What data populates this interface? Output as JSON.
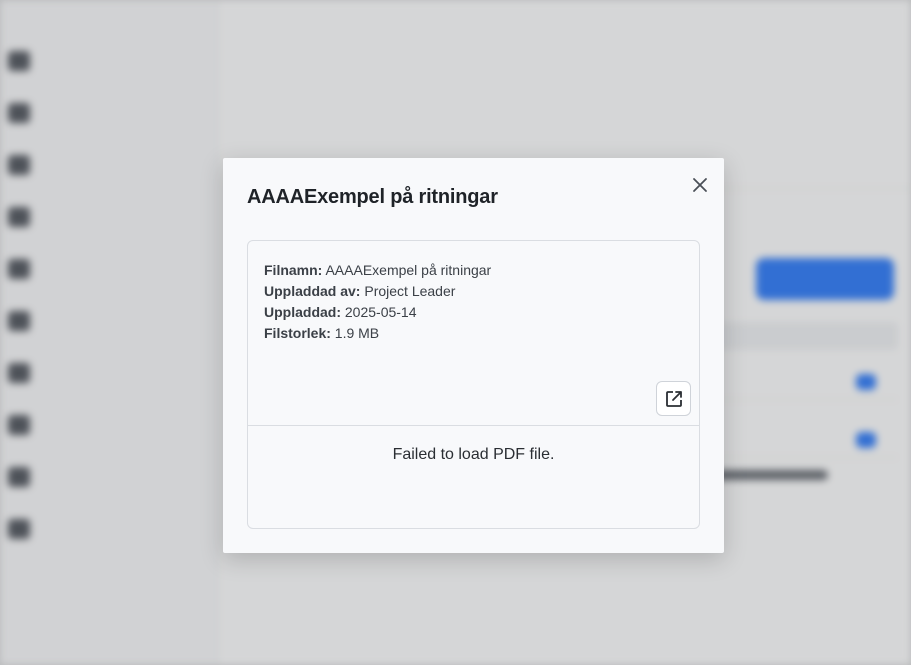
{
  "modal": {
    "title": "AAAAExempel på ritningar",
    "close_icon": "close-icon",
    "open_external_icon": "external-link-icon",
    "file_info": {
      "name_label": "Filnamn:",
      "name_value": "AAAAExempel på ritningar",
      "uploaded_by_label": "Uppladdad av:",
      "uploaded_by_value": "Project Leader",
      "uploaded_label": "Uppladdad:",
      "uploaded_value": "2025-05-14",
      "size_label": "Filstorlek:",
      "size_value": "1.9 MB"
    },
    "error_message": "Failed to load PDF file."
  },
  "colors": {
    "accent": "#3b82f6",
    "modal_bg": "#f8f9fb",
    "border": "#dadde2"
  }
}
